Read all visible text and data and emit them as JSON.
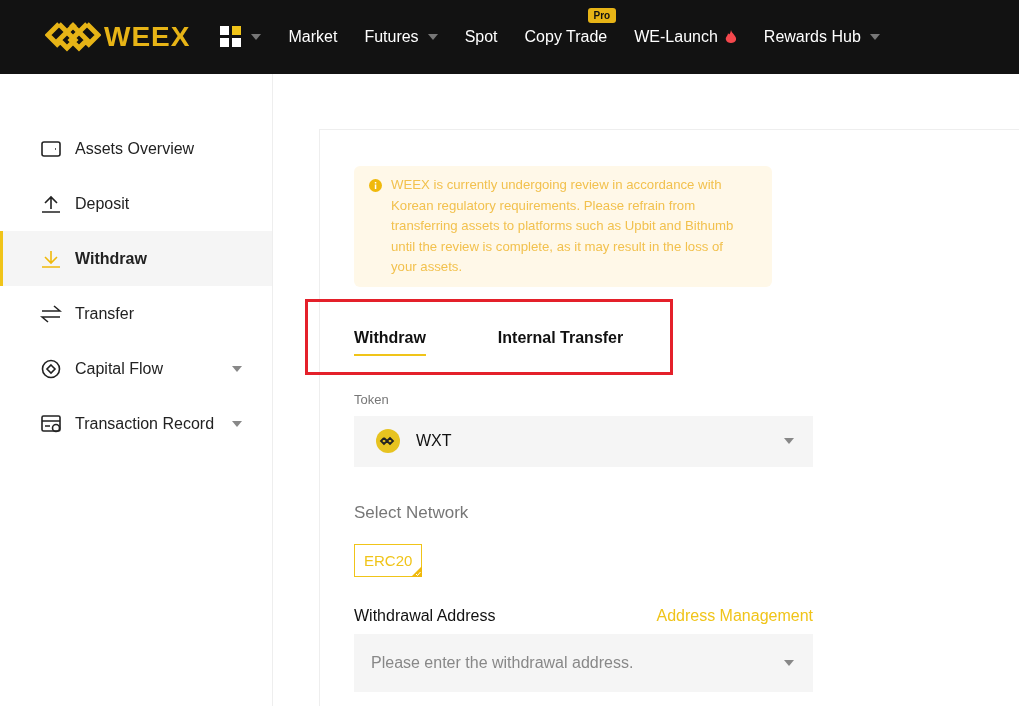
{
  "header": {
    "logo": "WEEX",
    "nav": [
      {
        "label": "Market",
        "has_dropdown": false,
        "hot": false
      },
      {
        "label": "Futures",
        "has_dropdown": true,
        "hot": false
      },
      {
        "label": "Spot",
        "has_dropdown": false,
        "hot": false
      },
      {
        "label": "Copy Trade",
        "has_dropdown": false,
        "badge": "Pro",
        "hot": false
      },
      {
        "label": "WE-Launch",
        "has_dropdown": false,
        "hot": true
      },
      {
        "label": "Rewards Hub",
        "has_dropdown": true,
        "hot": false
      }
    ]
  },
  "sidebar": {
    "items": [
      {
        "label": "Assets Overview",
        "selected": false,
        "has_dropdown": false
      },
      {
        "label": "Deposit",
        "selected": false,
        "has_dropdown": false
      },
      {
        "label": "Withdraw",
        "selected": true,
        "has_dropdown": false
      },
      {
        "label": "Transfer",
        "selected": false,
        "has_dropdown": false
      },
      {
        "label": "Capital Flow",
        "selected": false,
        "has_dropdown": true
      },
      {
        "label": "Transaction Record",
        "selected": false,
        "has_dropdown": true
      }
    ]
  },
  "notice": "WEEX is currently undergoing review in accordance with Korean regulatory requirements. Please refrain from transferring assets to platforms such as Upbit and Bithumb until the review is complete, as it may result in the loss of your assets.",
  "tabs": {
    "highlighted": true,
    "items": [
      {
        "label": "Withdraw",
        "selected": true
      },
      {
        "label": "Internal Transfer",
        "selected": false
      }
    ]
  },
  "token": {
    "label": "Token",
    "value": "WXT"
  },
  "network": {
    "label": "Select Network",
    "options": [
      {
        "label": "ERC20",
        "selected": true
      }
    ]
  },
  "address": {
    "label": "Withdrawal Address",
    "link": "Address Management",
    "placeholder": "Please enter the withdrawal address."
  }
}
